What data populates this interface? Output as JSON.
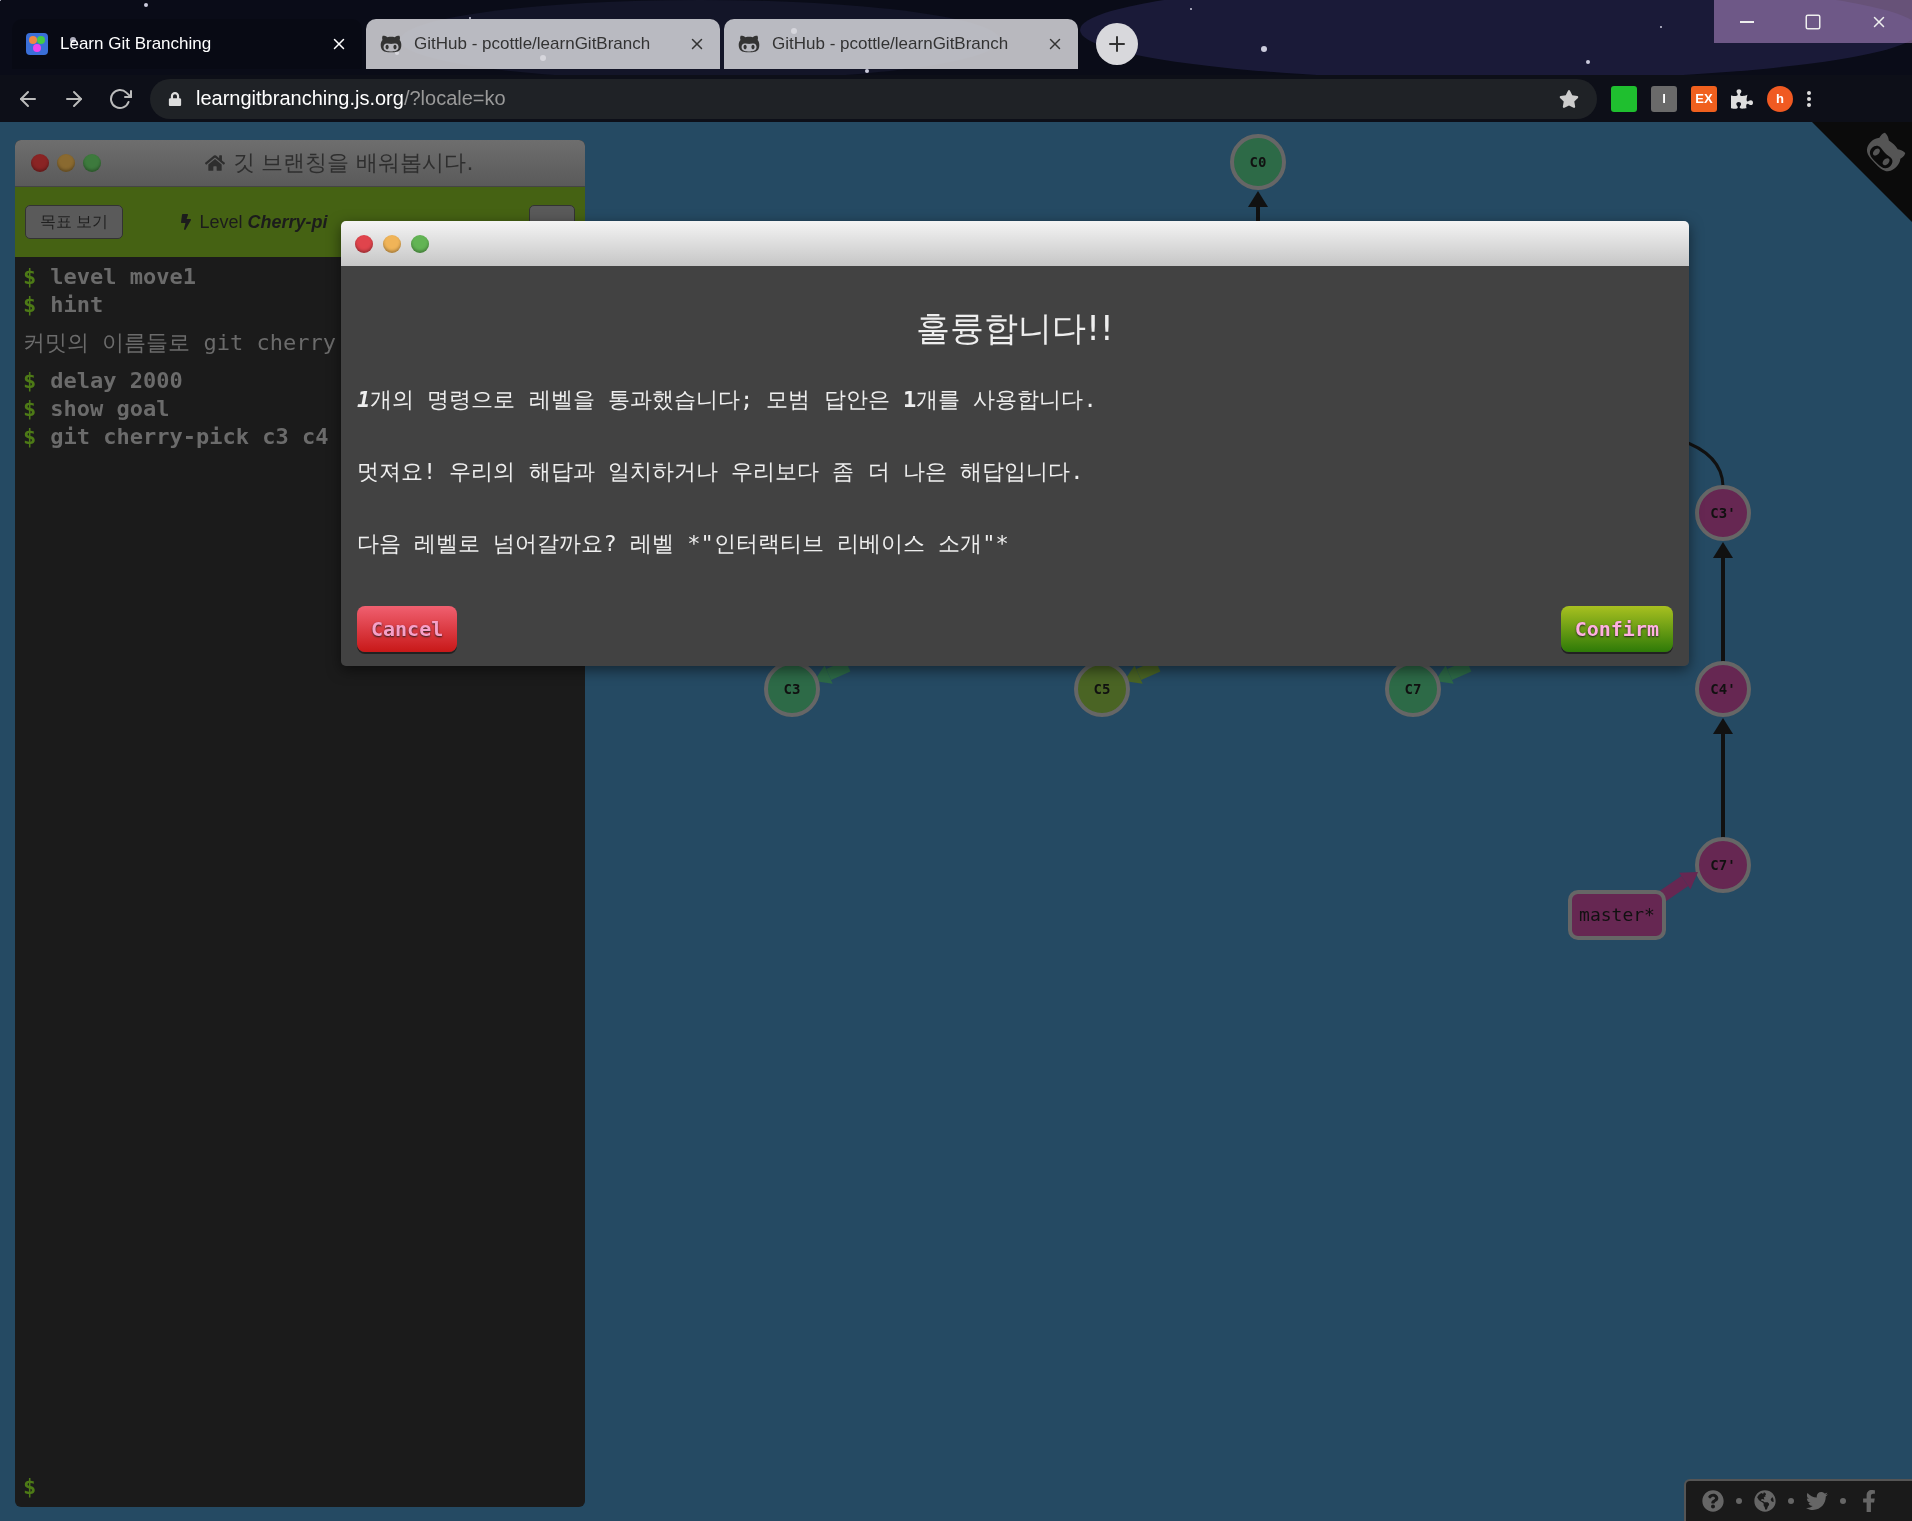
{
  "browser": {
    "tabs": [
      {
        "title": "Learn Git Branching",
        "selected": true
      },
      {
        "title": "GitHub - pcottle/learnGitBranch",
        "selected": false
      },
      {
        "title": "GitHub - pcottle/learnGitBranch",
        "selected": false
      }
    ],
    "url_host": "learngitbranching.js.org",
    "url_path": "/?locale=ko",
    "extensions": [
      {
        "kind": "square",
        "color": "#1fbf2f"
      },
      {
        "kind": "square",
        "label": "I",
        "color": "#6a6a6a"
      },
      {
        "kind": "square",
        "label": "EX",
        "color": "#f0601e"
      },
      {
        "kind": "puzzle"
      },
      {
        "kind": "avatar",
        "label": "h",
        "color": "#f05a22"
      },
      {
        "kind": "menu"
      }
    ]
  },
  "command_panel": {
    "title": "깃 브랜칭을 배워봅시다.",
    "goal_button": "목표 보기",
    "level_prefix": "Level",
    "level_name": "Cherry-pi",
    "lines": [
      {
        "kind": "command",
        "text": "level move1"
      },
      {
        "kind": "command",
        "text": "hint"
      },
      {
        "kind": "output",
        "text": "커밋의 이름들로 git cherry"
      },
      {
        "kind": "command",
        "text": "delay 2000"
      },
      {
        "kind": "command",
        "text": "show goal"
      },
      {
        "kind": "command",
        "text": "git cherry-pick c3 c4"
      }
    ],
    "prompt": "$"
  },
  "graph": {
    "commits": [
      {
        "label": "C0",
        "color": "#2d6a47"
      },
      {
        "label": "C3",
        "color": "#2d6a47"
      },
      {
        "label": "C5",
        "color": "#4a6424"
      },
      {
        "label": "C7",
        "color": "#2d6a47"
      },
      {
        "label": "C3'",
        "color": "#662752"
      },
      {
        "label": "C4'",
        "color": "#662752"
      },
      {
        "label": "C7'",
        "color": "#662752"
      }
    ],
    "branch": {
      "label": "master*",
      "color": "#662752"
    }
  },
  "dialog": {
    "heading": "훌륭합니다!!",
    "summary": {
      "lead": "1",
      "text": "개의 명령으로 레벨을 통과했습니다; 모범 답안은 **1**개를 사용합니다."
    },
    "paragraphs": [
      "멋져요! 우리의 해답과 일치하거나 우리보다 좀 더 나은 해답입니다.",
      "다음 레벨로 넘어갈까요? 레벨 *\"인터랙티브 리베이스 소개\"*"
    ],
    "cancel": "Cancel",
    "confirm": "Confirm"
  }
}
